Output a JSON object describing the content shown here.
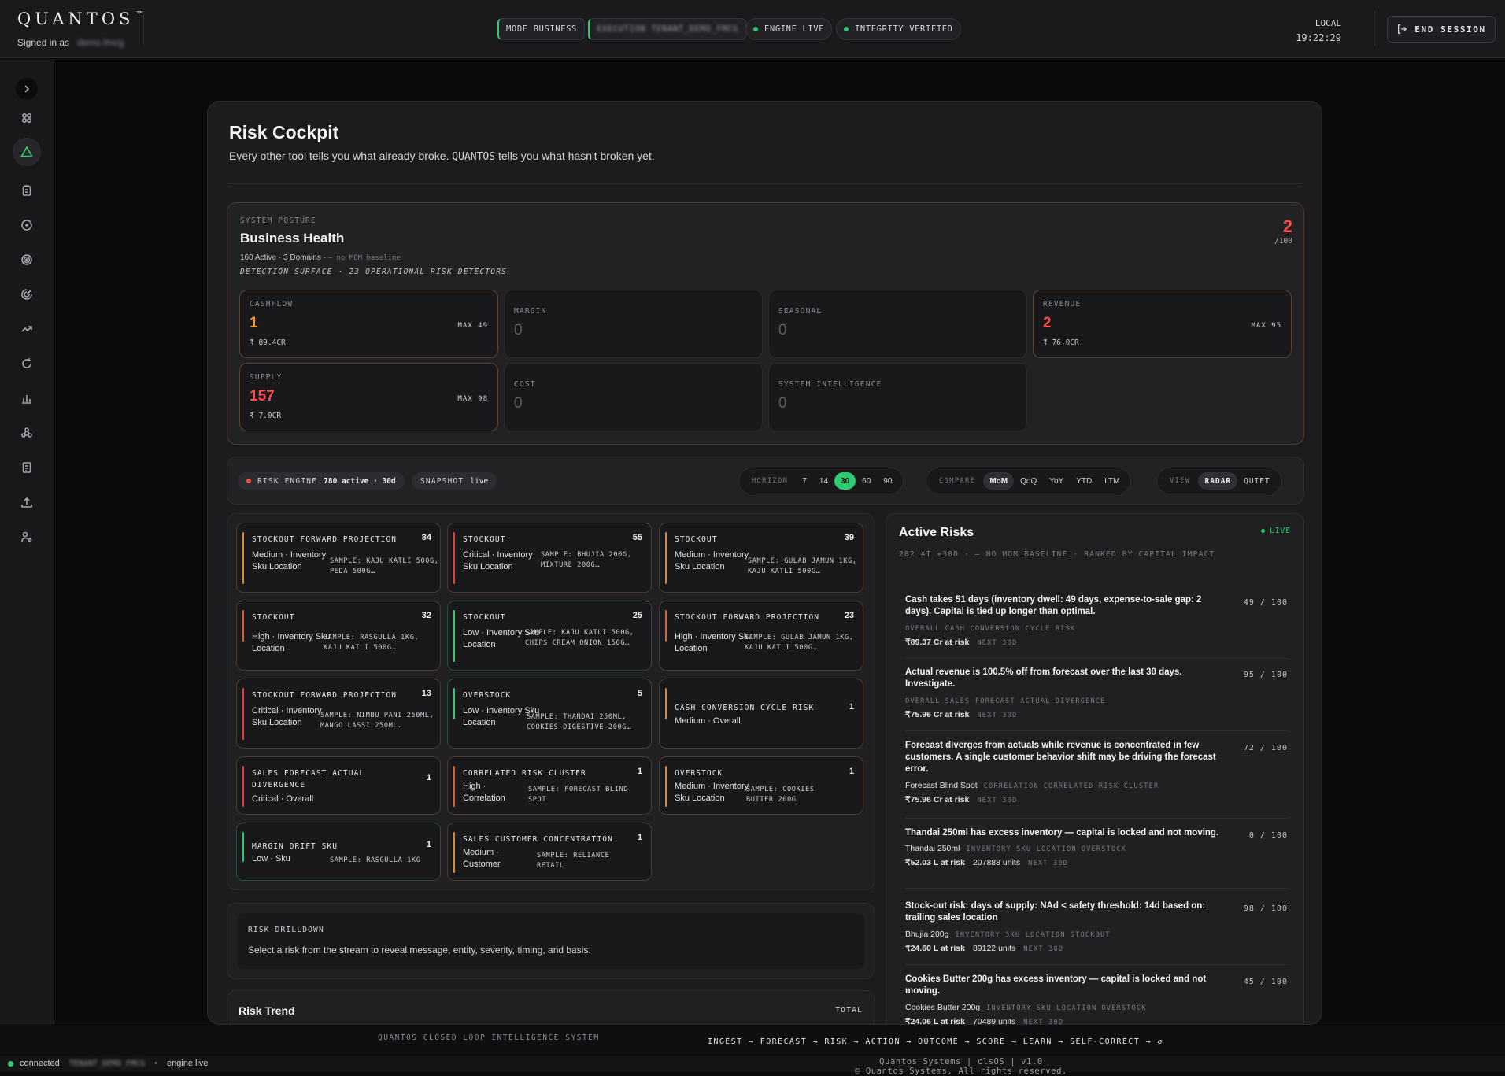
{
  "header": {
    "brand": "QUANTOS",
    "trademark": "™",
    "signed_in_label": "Signed in as",
    "signed_in_user": "demo.fmcg",
    "pills": {
      "mode": "MODE BUSINESS",
      "execution": "EXECUTION TENANT_DEMO_FMCG",
      "engine": "ENGINE LIVE",
      "integrity": "INTEGRITY VERIFIED"
    },
    "clock_label": "LOCAL",
    "clock_time": "19:22:29",
    "end_session": "END SESSION"
  },
  "sidebar": {
    "icons": [
      "chevron-right-icon",
      "grid-icon",
      "alert-triangle-icon",
      "clipboard-icon",
      "clock-icon",
      "target-icon",
      "radar-icon",
      "trend-up-icon",
      "refresh-icon",
      "bar-chart-icon",
      "nodes-icon",
      "document-icon",
      "upload-icon",
      "user-settings-icon"
    ],
    "active_index": 2
  },
  "page": {
    "title": "Risk Cockpit",
    "subtitle_pre": "Every other tool tells you what already broke.",
    "subtitle_brand": "QUANTOS",
    "subtitle_post": "tells you what hasn't broken yet."
  },
  "health": {
    "eyebrow": "SYSTEM POSTURE",
    "title": "Business Health",
    "meta_main": "160 Active · 3 Domains ·",
    "meta_note": "— no MOM baseline",
    "surface": "DETECTION SURFACE · 23 OPERATIONAL RISK DETECTORS",
    "score": "2",
    "score_denominator": "/100",
    "domains": [
      {
        "name": "CASHFLOW",
        "value": "1",
        "max": "MAX 49",
        "money": "₹ 89.4CR"
      },
      {
        "name": "MARGIN",
        "value": "0"
      },
      {
        "name": "SEASONAL",
        "value": "0"
      },
      {
        "name": "REVENUE",
        "value": "2",
        "max": "MAX 95",
        "money": "₹ 76.0CR"
      },
      {
        "name": "SUPPLY",
        "value": "157",
        "max": "MAX 98",
        "money": "₹ 7.0CR"
      },
      {
        "name": "COST",
        "value": "0"
      },
      {
        "name": "SYSTEM INTELLIGENCE",
        "value": "0"
      }
    ]
  },
  "controls": {
    "engine_label": "RISK ENGINE",
    "engine_value": "780 active · 30d",
    "snapshot_label": "SNAPSHOT",
    "snapshot_value": "live",
    "horizon_label": "HORIZON",
    "horizon_options": [
      "7",
      "14",
      "30",
      "60",
      "90"
    ],
    "horizon_selected": "30",
    "compare_label": "COMPARE",
    "compare_options": [
      "MoM",
      "QoQ",
      "YoY",
      "YTD",
      "LTM"
    ],
    "compare_selected": "MoM",
    "view_label": "VIEW",
    "view_options": [
      "RADAR",
      "QUIET"
    ],
    "view_selected": "RADAR"
  },
  "stream": [
    {
      "title": "STOCKOUT FORWARD PROJECTION",
      "count": "84",
      "severity": "Medium · Inventory Sku Location",
      "sample": "SAMPLE: KAJU KATLI 500G, PEDA 500G…",
      "accent": "#e08a2a"
    },
    {
      "title": "STOCKOUT",
      "count": "55",
      "severity": "Critical · Inventory Sku Location",
      "sample": "SAMPLE: BHUJIA 200G, MIXTURE 200G…",
      "accent": "#e0443a"
    },
    {
      "title": "STOCKOUT",
      "count": "39",
      "severity": "Medium · Inventory Sku Location",
      "sample": "SAMPLE: GULAB JAMUN 1KG, KAJU KATLI 500G…",
      "accent": "#e08a2a"
    },
    {
      "title": "STOCKOUT",
      "count": "32",
      "severity": "High · Inventory Sku Location",
      "sample": "SAMPLE: RASGULLA 1KG, KAJU KATLI 500G…",
      "accent": "#e0622a"
    },
    {
      "title": "STOCKOUT",
      "count": "25",
      "severity": "Low · Inventory Sku Location",
      "sample": "SAMPLE: KAJU KATLI 500G, CHIPS CREAM ONION 150G…",
      "accent": "#2ecc71"
    },
    {
      "title": "STOCKOUT FORWARD PROJECTION",
      "count": "23",
      "severity": "High · Inventory Sku Location",
      "sample": "SAMPLE: GULAB JAMUN 1KG, KAJU KATLI 500G…",
      "accent": "#e0622a"
    },
    {
      "title": "STOCKOUT FORWARD PROJECTION",
      "count": "13",
      "severity": "Critical · Inventory Sku Location",
      "sample": "SAMPLE: NIMBU PANI 250ML, MANGO LASSI 250ML…",
      "accent": "#e0443a"
    },
    {
      "title": "OVERSTOCK",
      "count": "5",
      "severity": "Low · Inventory Sku Location",
      "sample": "SAMPLE: THANDAI 250ML, COOKIES DIGESTIVE 200G…",
      "accent": "#2ecc71"
    },
    {
      "title": "CASH CONVERSION CYCLE RISK",
      "count": "1",
      "severity": "Medium · Overall",
      "sample": "",
      "accent": "#e08a2a"
    },
    {
      "title": "SALES FORECAST ACTUAL DIVERGENCE",
      "count": "1",
      "severity": "Critical · Overall",
      "sample": "",
      "accent": "#e0443a"
    },
    {
      "title": "CORRELATED RISK CLUSTER",
      "count": "1",
      "severity": "High · Correlation",
      "sample": "SAMPLE: FORECAST BLIND SPOT",
      "accent": "#e0622a"
    },
    {
      "title": "OVERSTOCK",
      "count": "1",
      "severity": "Medium · Inventory Sku Location",
      "sample": "SAMPLE: COOKIES BUTTER 200G",
      "accent": "#e08a2a"
    },
    {
      "title": "MARGIN DRIFT SKU",
      "count": "1",
      "severity": "Low · Sku",
      "sample": "SAMPLE: RASGULLA 1KG",
      "accent": "#2ecc71"
    },
    {
      "title": "SALES CUSTOMER CONCENTRATION",
      "count": "1",
      "severity": "Medium · Customer",
      "sample": "SAMPLE: RELIANCE RETAIL",
      "accent": "#e08a2a"
    }
  ],
  "drilldown": {
    "label": "RISK DRILLDOWN",
    "text": "Select a risk from the stream to reveal message, entity, severity, timing, and basis."
  },
  "trend": {
    "title": "Risk Trend",
    "right": "TOTAL"
  },
  "active": {
    "title": "Active Risks",
    "live": "LIVE",
    "description": "282 AT +30D · — NO MOM BASELINE · RANKED BY CAPITAL IMPACT",
    "items": [
      {
        "message": "Cash takes 51 days (inventory dwell: 49 days, expense-to-sale gap: 2 days). Capital is tied up longer than optimal.",
        "score": "49 / 100",
        "entity": "",
        "tag1": "OVERALL",
        "tag2": "CASH CONVERSION CYCLE RISK",
        "amount": "₹89.37 Cr at risk",
        "units": "",
        "next": "NEXT 30D"
      },
      {
        "message": "Actual revenue is 100.5% off from forecast over the last 30 days. Investigate.",
        "score": "95 / 100",
        "entity": "",
        "tag1": "OVERALL",
        "tag2": "SALES FORECAST ACTUAL DIVERGENCE",
        "amount": "₹75.96 Cr at risk",
        "units": "",
        "next": "NEXT 30D"
      },
      {
        "message": "Forecast diverges from actuals while revenue is concentrated in few customers. A single customer behavior shift may be driving the forecast error.",
        "score": "72 / 100",
        "entity": "Forecast Blind Spot",
        "tag1": "CORRELATION",
        "tag2": "CORRELATED RISK CLUSTER",
        "amount": "₹75.96 Cr at risk",
        "units": "",
        "next": "NEXT 30D"
      },
      {
        "message": "Thandai 250ml has excess inventory — capital is locked and not moving.",
        "score": "0 / 100",
        "entity": "Thandai 250ml",
        "tag1": "INVENTORY SKU LOCATION",
        "tag2": "OVERSTOCK",
        "amount": "₹52.03 L at risk",
        "units": "207888 units",
        "next": "NEXT 30D"
      },
      {
        "message": "Stock-out risk: days of supply: NAd < safety threshold: 14d based on: trailing sales location",
        "score": "98 / 100",
        "entity": "Bhujia 200g",
        "tag1": "INVENTORY SKU LOCATION",
        "tag2": "STOCKOUT",
        "amount": "₹24.60 L at risk",
        "units": "89122 units",
        "next": "NEXT 30D"
      },
      {
        "message": "Cookies Butter 200g has excess inventory — capital is locked and not moving.",
        "score": "45 / 100",
        "entity": "Cookies Butter 200g",
        "tag1": "INVENTORY SKU LOCATION",
        "tag2": "OVERSTOCK",
        "amount": "₹24.06 L at risk",
        "units": "70489 units",
        "next": "NEXT 30D"
      }
    ]
  },
  "footer": {
    "system_label": "QUANTOS CLOSED LOOP INTELLIGENCE SYSTEM",
    "loop": "INGEST → FORECAST → RISK → ACTION → OUTCOME → SCORE → LEARN → SELF-CORRECT → ↺",
    "connected": "connected",
    "tenant": "TENANT_DEMO_FMCG",
    "engine": "engine live",
    "copyright_1": "Quantos Systems | clsOS | v1.0",
    "copyright_2": "© Quantos Systems. All rights reserved."
  },
  "colors": {
    "accent_green": "#2ecc71",
    "critical_red": "#ff4b4b",
    "warn_orange": "#ff9a1f"
  }
}
